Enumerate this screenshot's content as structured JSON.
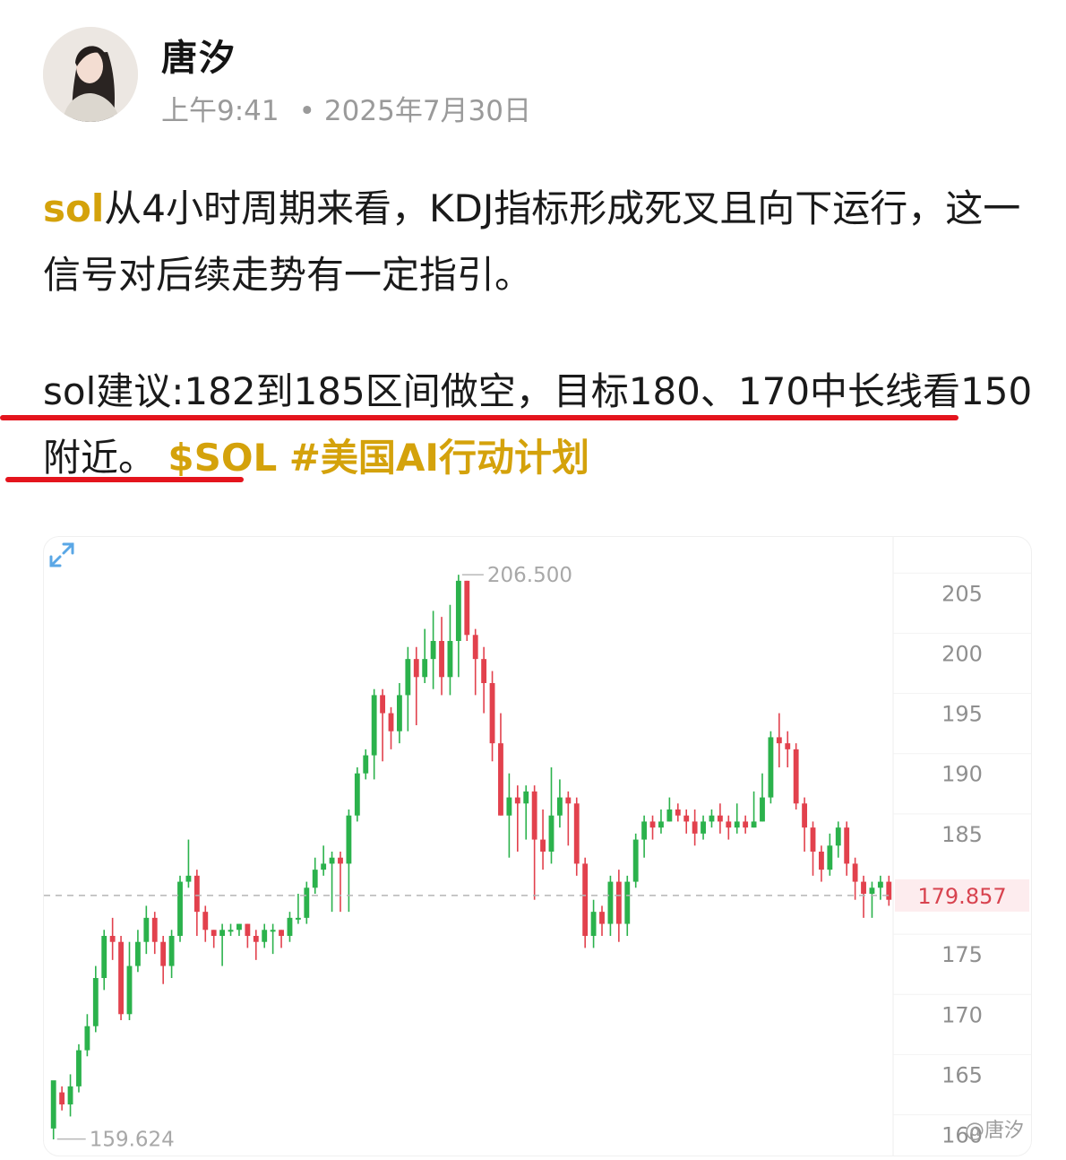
{
  "author": {
    "name": "唐汐",
    "time": "上午9:41",
    "date": "2025年7月30日"
  },
  "post": {
    "sol_tag": "sol",
    "line1_rest": "从4小时周期来看，KDJ指标形成死叉且向下运行，这一信号对后续走势有一定指引。",
    "line2a": "sol建议:182到185区间做空，目标180、170中长线看150附近。",
    "cashtag": "$SOL",
    "hashtag": "#美国AI行动计划"
  },
  "watermark": "@唐汐",
  "colors": {
    "up": "#2bb24c",
    "down": "#e2414d",
    "accent": "#d4a20b",
    "underline": "#e4141d"
  },
  "chart_data": {
    "type": "candlestick",
    "y_ticks": [
      205,
      200,
      195,
      190,
      185,
      175,
      170,
      165,
      160
    ],
    "ylim": [
      159,
      208
    ],
    "high_label": "206.500",
    "low_label": "159.624",
    "current_price": "179.857",
    "candles": [
      [
        160.5,
        164.5,
        159.6,
        163.5
      ],
      [
        163.5,
        162.5,
        162.0,
        164.0
      ],
      [
        162.5,
        164.0,
        161.5,
        165.0
      ],
      [
        164.0,
        167.0,
        163.5,
        167.5
      ],
      [
        167.0,
        169.0,
        166.5,
        170.0
      ],
      [
        169.0,
        173.0,
        168.5,
        174.0
      ],
      [
        173.0,
        176.5,
        172.0,
        177.0
      ],
      [
        176.5,
        176.0,
        174.5,
        178.0
      ],
      [
        176.0,
        170.0,
        169.5,
        176.5
      ],
      [
        170.0,
        174.0,
        169.5,
        176.0
      ],
      [
        174.0,
        176.0,
        173.5,
        177.0
      ],
      [
        176.0,
        178.0,
        175.0,
        179.0
      ],
      [
        178.0,
        176.0,
        175.0,
        178.5
      ],
      [
        176.0,
        174.0,
        172.5,
        176.5
      ],
      [
        174.0,
        176.5,
        173.0,
        177.0
      ],
      [
        176.5,
        181.0,
        176.0,
        181.5
      ],
      [
        181.0,
        181.5,
        180.5,
        184.5
      ],
      [
        181.5,
        178.5,
        176.5,
        182.0
      ],
      [
        178.5,
        177.0,
        176.0,
        179.0
      ],
      [
        177.0,
        176.5,
        175.5,
        177.0
      ],
      [
        176.5,
        177.0,
        174.0,
        177.5
      ],
      [
        177.0,
        177.0,
        176.5,
        177.5
      ],
      [
        177.0,
        177.5,
        176.5,
        177.5
      ],
      [
        177.5,
        176.5,
        175.5,
        177.5
      ],
      [
        176.5,
        176.0,
        174.5,
        177.0
      ],
      [
        176.0,
        177.0,
        175.5,
        177.5
      ],
      [
        177.0,
        177.0,
        175.0,
        177.5
      ],
      [
        177.0,
        176.5,
        175.5,
        177.0
      ],
      [
        176.5,
        178.0,
        176.0,
        178.5
      ],
      [
        178.0,
        178.0,
        177.5,
        180.0
      ],
      [
        178.0,
        180.5,
        177.5,
        181.0
      ],
      [
        180.5,
        182.0,
        180.0,
        183.0
      ],
      [
        182.0,
        182.5,
        181.5,
        184.0
      ],
      [
        182.5,
        183.0,
        178.5,
        183.5
      ],
      [
        183.0,
        182.5,
        178.5,
        183.5
      ],
      [
        182.5,
        186.5,
        178.5,
        187.0
      ],
      [
        186.5,
        190.0,
        186.0,
        190.5
      ],
      [
        190.0,
        191.5,
        189.5,
        192.0
      ],
      [
        191.5,
        196.5,
        189.5,
        197.0
      ],
      [
        196.5,
        195.0,
        191.0,
        197.0
      ],
      [
        195.0,
        193.5,
        192.0,
        195.5
      ],
      [
        193.5,
        196.5,
        192.5,
        197.5
      ],
      [
        196.5,
        199.5,
        193.5,
        200.5
      ],
      [
        199.5,
        198.0,
        194.0,
        200.5
      ],
      [
        198.0,
        199.5,
        197.5,
        202.0
      ],
      [
        199.5,
        201.0,
        197.0,
        203.5
      ],
      [
        201.0,
        198.0,
        196.5,
        203.0
      ],
      [
        198.0,
        201.0,
        196.5,
        204.0
      ],
      [
        201.0,
        206.0,
        198.0,
        206.5
      ],
      [
        206.0,
        201.5,
        201.0,
        206.0
      ],
      [
        201.5,
        199.5,
        196.5,
        202.0
      ],
      [
        199.5,
        197.5,
        195.0,
        200.5
      ],
      [
        197.5,
        192.5,
        191.0,
        198.5
      ],
      [
        192.5,
        186.5,
        186.5,
        195.0
      ],
      [
        186.5,
        188.0,
        183.0,
        190.0
      ],
      [
        188.0,
        187.5,
        183.5,
        189.0
      ],
      [
        187.5,
        188.5,
        184.5,
        189.0
      ],
      [
        188.5,
        184.5,
        179.5,
        189.0
      ],
      [
        184.5,
        183.5,
        182.0,
        187.0
      ],
      [
        183.5,
        186.5,
        182.5,
        190.5
      ],
      [
        186.5,
        188.0,
        185.5,
        189.5
      ],
      [
        188.0,
        187.5,
        184.0,
        188.5
      ],
      [
        187.5,
        182.5,
        181.5,
        188.0
      ],
      [
        182.5,
        176.5,
        175.5,
        183.0
      ],
      [
        176.5,
        178.5,
        175.5,
        179.5
      ],
      [
        178.5,
        177.5,
        176.5,
        179.0
      ],
      [
        177.5,
        181.0,
        176.5,
        181.5
      ],
      [
        181.0,
        177.5,
        176.0,
        182.0
      ],
      [
        177.5,
        181.0,
        176.5,
        181.5
      ],
      [
        181.0,
        184.5,
        180.5,
        185.0
      ],
      [
        184.5,
        186.0,
        183.0,
        186.5
      ],
      [
        186.0,
        185.5,
        184.5,
        186.5
      ],
      [
        185.5,
        186.0,
        185.0,
        187.0
      ],
      [
        186.0,
        187.0,
        186.0,
        188.0
      ],
      [
        187.0,
        186.5,
        186.0,
        187.5
      ],
      [
        186.5,
        186.0,
        185.0,
        187.0
      ],
      [
        186.0,
        185.0,
        184.0,
        187.0
      ],
      [
        185.0,
        186.0,
        184.5,
        186.5
      ],
      [
        186.0,
        186.5,
        185.5,
        187.0
      ],
      [
        186.5,
        186.0,
        185.0,
        187.5
      ],
      [
        186.0,
        185.5,
        184.5,
        186.5
      ],
      [
        185.5,
        186.0,
        185.0,
        187.5
      ],
      [
        186.0,
        185.5,
        185.0,
        186.5
      ],
      [
        185.5,
        186.0,
        185.5,
        188.5
      ],
      [
        186.0,
        188.0,
        186.0,
        190.0
      ],
      [
        188.0,
        193.0,
        187.5,
        193.5
      ],
      [
        193.0,
        192.5,
        190.5,
        195.0
      ],
      [
        192.5,
        192.0,
        190.5,
        193.5
      ],
      [
        192.0,
        187.5,
        187.0,
        192.5
      ],
      [
        187.5,
        185.5,
        183.5,
        188.0
      ],
      [
        185.5,
        183.5,
        181.5,
        186.0
      ],
      [
        183.5,
        182.0,
        181.0,
        184.0
      ],
      [
        182.0,
        184.0,
        181.5,
        185.0
      ],
      [
        184.0,
        185.5,
        183.0,
        186.0
      ],
      [
        185.5,
        182.5,
        181.5,
        186.0
      ],
      [
        182.5,
        181.0,
        179.5,
        183.0
      ],
      [
        181.0,
        180.0,
        178.0,
        181.5
      ],
      [
        180.0,
        180.5,
        178.0,
        181.0
      ],
      [
        180.5,
        181.0,
        179.5,
        181.5
      ],
      [
        181.0,
        179.5,
        179.0,
        181.5
      ]
    ]
  }
}
